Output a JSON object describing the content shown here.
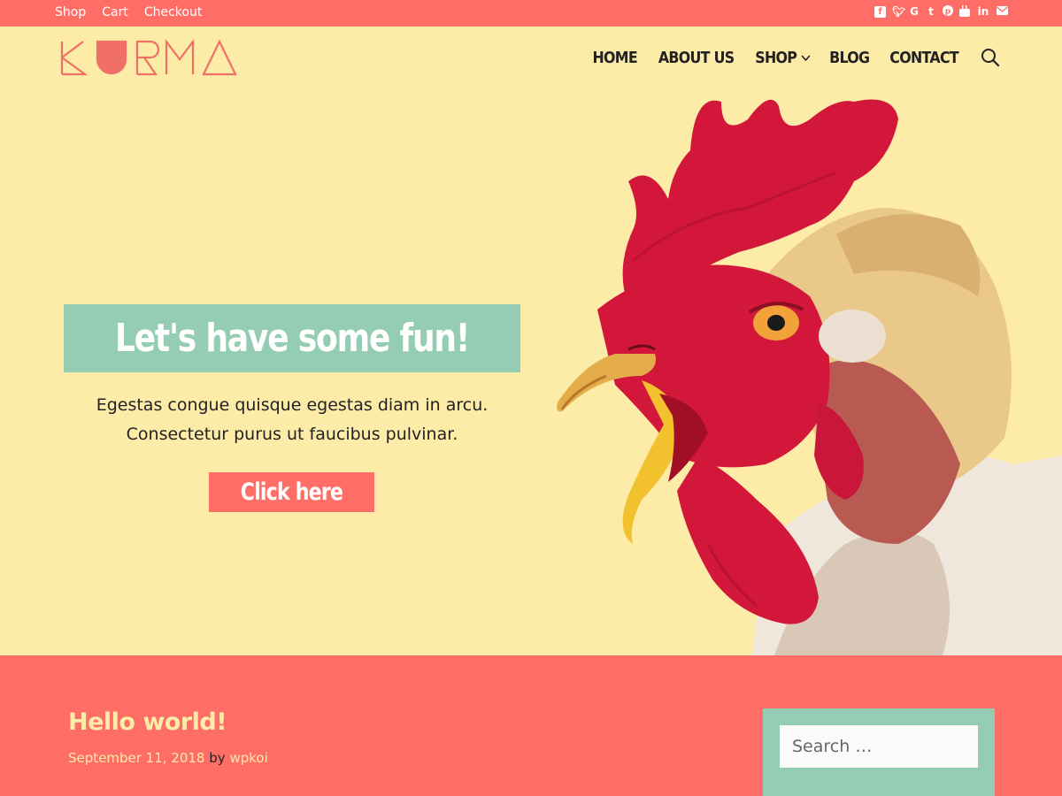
{
  "topbar": {
    "links": [
      "Shop",
      "Cart",
      "Checkout"
    ],
    "social_icons": [
      "facebook-icon",
      "twitter-icon",
      "google-icon",
      "tumblr-icon",
      "pinterest-icon",
      "youtube-icon",
      "linkedin-icon",
      "email-icon"
    ]
  },
  "header": {
    "logo_text": "KURMA",
    "nav": [
      {
        "label": "HOME"
      },
      {
        "label": "ABOUT US"
      },
      {
        "label": "SHOP",
        "has_dropdown": true
      },
      {
        "label": "BLOG"
      },
      {
        "label": "CONTACT"
      }
    ],
    "search_icon": "search-icon"
  },
  "hero": {
    "title": "Let's have some fun!",
    "text_line1": "Egestas congue quisque egestas diam in arcu.",
    "text_line2": "Consectetur purus ut faucibus pulvinar.",
    "button": "Click here"
  },
  "post": {
    "title": "Hello world!",
    "date": "September 11, 2018",
    "by": "by",
    "author": "wpkoi"
  },
  "sidebar": {
    "search_placeholder": "Search …"
  },
  "colors": {
    "coral": "#ff6e66",
    "cream": "#fdeba8",
    "mint": "#94cdb4",
    "dark": "#222222"
  }
}
